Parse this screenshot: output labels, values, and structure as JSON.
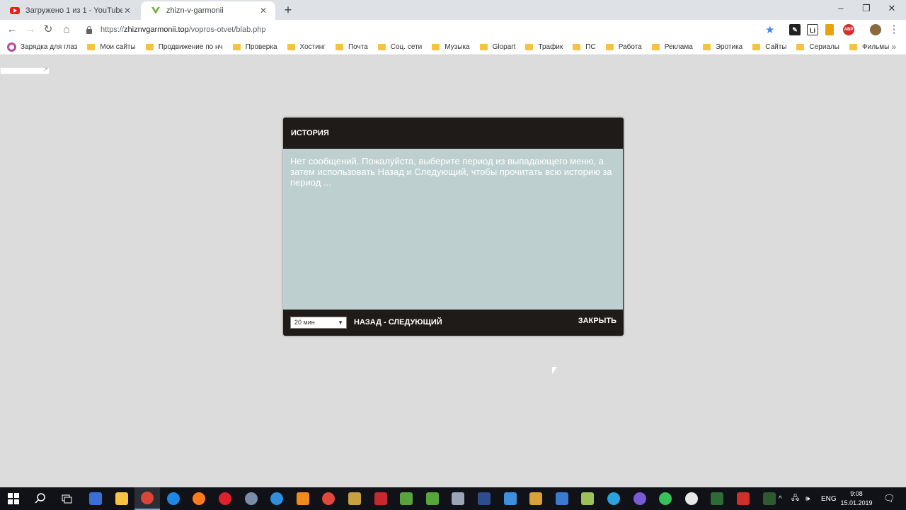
{
  "browser": {
    "tabs": [
      {
        "title": "Загружено 1 из 1 - YouTube",
        "icon": "youtube-icon",
        "active": false
      },
      {
        "title": "zhizn-v-garmonii",
        "icon": "site-favicon",
        "active": true
      }
    ],
    "new_tab_symbol": "+",
    "window_controls": {
      "minimize": "–",
      "maximize": "❐",
      "close": "✕"
    },
    "nav": {
      "back": "←",
      "forward": "→",
      "reload": "↻",
      "home": "⌂"
    },
    "url": {
      "scheme": "https://",
      "host": "zhiznvgarmonii.top",
      "path": "/vopros-otvet/blab.php"
    },
    "star": "★",
    "extensions": [
      {
        "name": "pencil-extension-icon",
        "label": "✎",
        "bg": "#222222",
        "fg": "#ffffff"
      },
      {
        "name": "li-extension-icon",
        "label": "Li",
        "bg": "#ffffff",
        "fg": "#222222"
      },
      {
        "name": "bookmark-extension-icon",
        "label": "",
        "bg": "#e8a210",
        "fg": "#ffffff"
      },
      {
        "name": "adblock-extension-icon",
        "label": "ABP",
        "bg": "#d32f2f",
        "fg": "#ffffff"
      },
      {
        "name": "profile-avatar-icon",
        "label": "",
        "bg": "#8a6a3c",
        "fg": "#ffffff"
      }
    ],
    "menu_symbol": "⋮",
    "bookmarks": [
      "Зарядка для глаз",
      "Мои сайты",
      "Продвижение по нч",
      "Проверка",
      "Хостинг",
      "Почта",
      "Соц. сети",
      "Музыка",
      "Glopart",
      "Трафик",
      "ПС",
      "Работа",
      "Реклама",
      "Эротика",
      "Сайты",
      "Сериалы",
      "Фильмы"
    ],
    "bookmarks_more": "»"
  },
  "dialog": {
    "title": "ИСТОРИЯ",
    "message": "Нет сообщений. Пожалуйста, выберите период из выпадающего меню, а затем использовать Назад и Следующий, чтобы прочитать всю историю за период ...",
    "period_select": {
      "value": "20 мин",
      "arrow": "▼"
    },
    "nav_links": "НАЗАД - СЛЕДУЮЩИЙ",
    "close_label": "ЗАКРЫТЬ"
  },
  "taskbar": {
    "apps": [
      {
        "name": "start-button",
        "color": "#ffffff"
      },
      {
        "name": "search-icon",
        "color": "#ffffff"
      },
      {
        "name": "task-view-icon",
        "color": "#ffffff"
      },
      {
        "name": "save-app-icon",
        "color": "#3a6fd8"
      },
      {
        "name": "file-explorer-icon",
        "color": "#f5c542"
      },
      {
        "name": "chrome-icon",
        "color": "#db4437"
      },
      {
        "name": "edge-icon",
        "color": "#1e88e5"
      },
      {
        "name": "firefox-icon",
        "color": "#ff7a1a"
      },
      {
        "name": "opera-icon",
        "color": "#e0202a"
      },
      {
        "name": "globe-app-icon",
        "color": "#7a8da8"
      },
      {
        "name": "browser-app-icon",
        "color": "#2f8fde"
      },
      {
        "name": "avast-icon",
        "color": "#f08a1d"
      },
      {
        "name": "ccleaner-icon",
        "color": "#e0483b"
      },
      {
        "name": "notes-app-icon",
        "color": "#c9a040"
      },
      {
        "name": "filezilla-icon",
        "color": "#c8272d"
      },
      {
        "name": "notepad-plus-icon",
        "color": "#5aa43c"
      },
      {
        "name": "utorrent-icon",
        "color": "#57a63b"
      },
      {
        "name": "audio-app-icon",
        "color": "#9aa6b8"
      },
      {
        "name": "photoshop-icon",
        "color": "#2d4d8f"
      },
      {
        "name": "settings-gear-icon",
        "color": "#3d8fe0"
      },
      {
        "name": "user-app-icon",
        "color": "#d8a23a"
      },
      {
        "name": "screen-app-icon",
        "color": "#3a7ad0"
      },
      {
        "name": "folder-app-icon",
        "color": "#9bc15a"
      },
      {
        "name": "telegram-icon",
        "color": "#2aa3de"
      },
      {
        "name": "viber-icon",
        "color": "#7b5ad6"
      },
      {
        "name": "whatsapp-icon",
        "color": "#37c25a"
      },
      {
        "name": "info-app-icon",
        "color": "#e8e8e8"
      },
      {
        "name": "dreamweaver-icon",
        "color": "#2e6b35"
      },
      {
        "name": "vector-app-icon",
        "color": "#d0302a"
      },
      {
        "name": "green-app-icon",
        "color": "#2f5a2f"
      }
    ],
    "tray": {
      "chevron": "^",
      "network": "🖧",
      "volume": "🕪",
      "language": "ENG"
    },
    "clock": {
      "time": "9:08",
      "date": "15.01.2019"
    },
    "notifications": "🗨"
  }
}
